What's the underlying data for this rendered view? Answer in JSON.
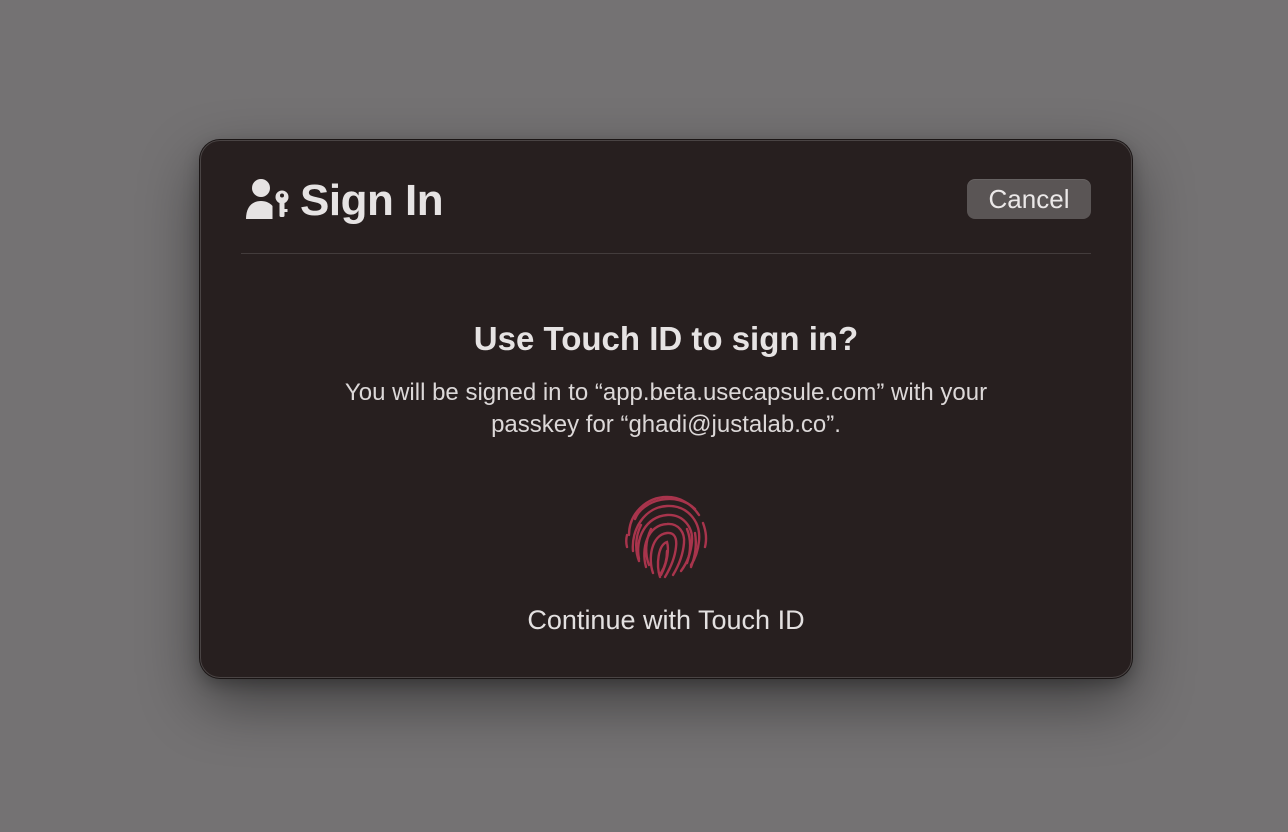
{
  "dialog": {
    "title": "Sign In",
    "header_icon": "person-key-icon",
    "cancel_label": "Cancel",
    "prompt": "Use Touch ID to sign in?",
    "body_line_1": "You will be signed in to “app.beta.usecapsule.com” with your",
    "body_line_2": "passkey for “ghadi@justalab.co”.",
    "fingerprint_icon": "fingerprint-icon",
    "continue_label": "Continue with Touch ID"
  },
  "colors": {
    "backdrop": "#747273",
    "dialog_background": "#271f1f",
    "cancel_button": "#5a5555",
    "fingerprint": "#a8344c",
    "text": "#e6e3e3"
  }
}
